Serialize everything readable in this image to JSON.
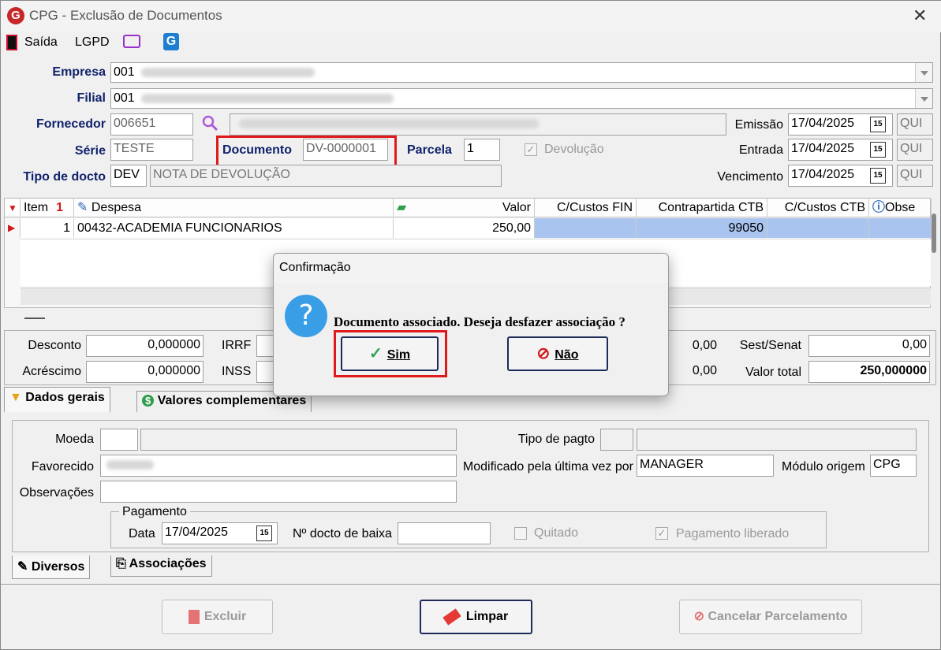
{
  "window": {
    "title": "CPG - Exclusão de Documentos"
  },
  "menu": {
    "exit": "Saída",
    "lgpd": "LGPD"
  },
  "header": {
    "empresa_label": "Empresa",
    "empresa_code": "001",
    "filial_label": "Filial",
    "filial_code": "001",
    "fornecedor_label": "Fornecedor",
    "fornecedor_code": "006651",
    "serie_label": "Série",
    "serie_value": "TESTE",
    "documento_label": "Documento",
    "documento_value": "DV-0000001",
    "parcela_label": "Parcela",
    "parcela_value": "1",
    "devolucao_label": "Devolução",
    "tipo_label": "Tipo de docto",
    "tipo_code": "DEV",
    "tipo_desc": "NOTA DE DEVOLUÇÃO",
    "emissao_label": "Emissão",
    "emissao_value": "17/04/2025",
    "emissao_day": "QUI",
    "entrada_label": "Entrada",
    "entrada_value": "17/04/2025",
    "entrada_day": "QUI",
    "vencimento_label": "Vencimento",
    "vencimento_value": "17/04/2025",
    "vencimento_day": "QUI"
  },
  "grid": {
    "columns": [
      "Item",
      "Despesa",
      "Valor",
      "C/Custos FIN",
      "Contrapartida CTB",
      "C/Custos CTB",
      "Obse"
    ],
    "rows": [
      {
        "item": "1",
        "despesa": "00432-ACADEMIA FUNCIONARIOS",
        "valor": "250,00",
        "cc_fin": "",
        "contrapartida": "99050",
        "cc_ctb": "",
        "obs": ""
      }
    ]
  },
  "totals": {
    "desconto_label": "Desconto",
    "desconto_value": "0,000000",
    "acrescimo_label": "Acréscimo",
    "acrescimo_value": "0,000000",
    "irrf_label": "IRRF",
    "inss_label": "INSS",
    "mid1_value": "0,00",
    "mid2_value": "0,00",
    "sest_label": "Sest/Senat",
    "sest_value": "0,00",
    "valor_total_label": "Valor total",
    "valor_total_value": "250,000000"
  },
  "tabs": {
    "dados_gerais": "Dados gerais",
    "valores_complementares": "Valores complementares",
    "diversos": "Diversos",
    "associacoes": "Associações"
  },
  "general": {
    "moeda_label": "Moeda",
    "favorecido_label": "Favorecido",
    "observacoes_label": "Observações",
    "tipo_pagto_label": "Tipo de pagto",
    "modificado_label": "Modificado pela última vez por",
    "modificado_value": "MANAGER",
    "modulo_label": "Módulo origem",
    "modulo_value": "CPG",
    "pagamento_group": "Pagamento",
    "data_label": "Data",
    "data_value": "17/04/2025",
    "docto_baixa_label": "Nº docto de baixa",
    "quitado_label": "Quitado",
    "pagamento_liberado_label": "Pagamento liberado"
  },
  "buttons": {
    "excluir": "Excluir",
    "limpar": "Limpar",
    "cancelar_parcelamento": "Cancelar Parcelamento"
  },
  "dialog": {
    "title": "Confirmação",
    "message": "Documento associado. Deseja desfazer associação ?",
    "yes": "Sim",
    "no": "Não"
  },
  "colors": {
    "label_blue": "#10226b",
    "selection": "#a9c4ee",
    "highlight_red": "#e01a1a",
    "dialog_icon": "#3a9ee6"
  }
}
